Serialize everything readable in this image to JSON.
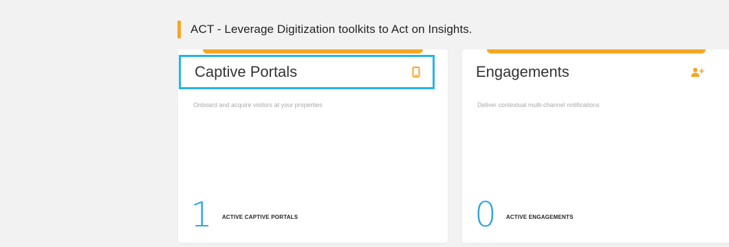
{
  "section": {
    "title": "ACT - Leverage Digitization toolkits to Act on Insights."
  },
  "cards": [
    {
      "title": "Captive Portals",
      "icon": "phone-icon",
      "description": "Onboard and acquire visitors at your properties",
      "stat_value": "1",
      "stat_label": "ACTIVE CAPTIVE PORTALS"
    },
    {
      "title": "Engagements",
      "icon": "add-user-icon",
      "description": "Deliver contextual multi-channel notifications",
      "stat_value": "0",
      "stat_label": "ACTIVE ENGAGEMENTS"
    }
  ],
  "colors": {
    "accent": "#f5a623",
    "highlight": "#21b4e8",
    "stat_number": "#2ea5dc",
    "background": "#f2f2f2"
  }
}
